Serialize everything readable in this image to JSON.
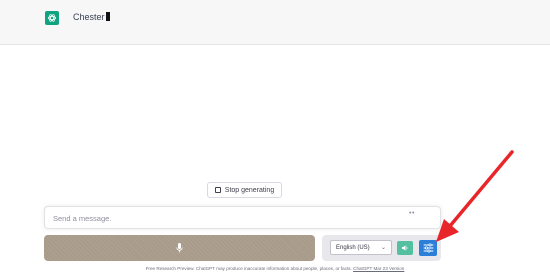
{
  "conversation": {
    "user_message": "Chester"
  },
  "stop_button": {
    "label": "Stop generating"
  },
  "composer": {
    "placeholder": "Send a message.",
    "dots": "••"
  },
  "voice_controls": {
    "mic_icon": "microphone-icon",
    "language_selected": "English (US)",
    "speaker_icon": "speaker-icon",
    "settings_icon": "sliders-icon"
  },
  "footer": {
    "text": "Free Research Preview. ChatGPT may produce inaccurate information about people, places, or facts. ",
    "link_text": "ChatGPT Mar 23 Version"
  },
  "colors": {
    "brand": "#10a37f",
    "settings_button": "#2b7fd8",
    "speaker_button": "#55c0a0",
    "mic_bar": "#a99b8a",
    "annotation_arrow": "#e8262a"
  }
}
